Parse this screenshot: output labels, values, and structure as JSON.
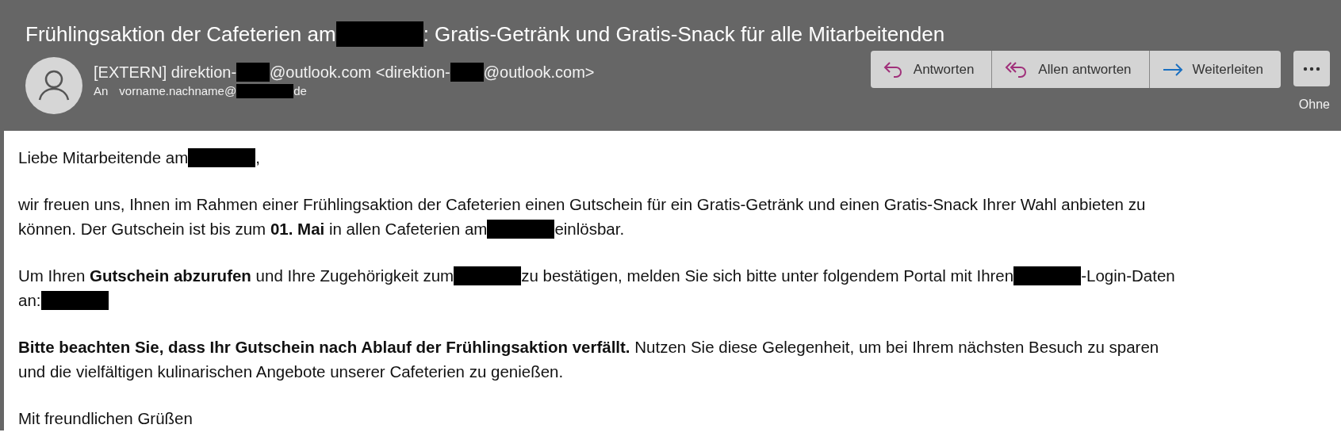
{
  "subject": [
    {
      "kind": "text",
      "text": "Frühlingsaktion der Cafeterien am"
    },
    {
      "kind": "redaction"
    },
    {
      "kind": "text",
      "text": ": Gratis-Getränk und Gratis-Snack für alle Mitarbeitenden"
    }
  ],
  "sender": [
    {
      "kind": "text",
      "text": "[EXTERN] direktion-"
    },
    {
      "kind": "redaction"
    },
    {
      "kind": "text",
      "text": "@outlook.com <direktion-"
    },
    {
      "kind": "redaction"
    },
    {
      "kind": "text",
      "text": "@outlook.com>"
    }
  ],
  "to_label": "An",
  "recipient": [
    {
      "kind": "text",
      "text": "vorname.nachname@"
    },
    {
      "kind": "redaction"
    },
    {
      "kind": "text",
      "text": "de"
    }
  ],
  "actions": [
    {
      "kind": "reply",
      "label": "Antworten"
    },
    {
      "kind": "reply_all",
      "label": "Allen antworten"
    },
    {
      "kind": "forward",
      "label": "Weiterleiten"
    }
  ],
  "more_label": "Ohne",
  "body": [
    [
      [
        {
          "kind": "text",
          "text": "Liebe Mitarbeitende am"
        },
        {
          "kind": "redaction"
        },
        {
          "kind": "text",
          "text": ","
        }
      ]
    ],
    [
      [
        {
          "kind": "text",
          "text": "wir freuen uns, Ihnen im Rahmen einer Frühlingsaktion der Cafeterien einen Gutschein für ein Gratis-Getränk und einen Gratis-Snack Ihrer Wahl anbieten zu"
        }
      ],
      [
        {
          "kind": "text",
          "text": "können. Der Gutschein ist bis zum **01. Mai** in allen Cafeterien am"
        },
        {
          "kind": "redaction"
        },
        {
          "kind": "text",
          "text": "einlösbar."
        }
      ]
    ],
    [
      [
        {
          "kind": "text",
          "text": "Um Ihren **Gutschein abzurufen** und Ihre Zugehörigkeit zum"
        },
        {
          "kind": "redaction"
        },
        {
          "kind": "text",
          "text": "zu bestätigen, melden Sie sich bitte unter folgendem Portal mit Ihren"
        },
        {
          "kind": "redaction"
        },
        {
          "kind": "text",
          "text": "-Login-Daten"
        }
      ],
      [
        {
          "kind": "text",
          "text": "an:"
        },
        {
          "kind": "redaction"
        }
      ]
    ],
    [
      [
        {
          "kind": "text",
          "text": "**Bitte beachten Sie, dass Ihr Gutschein nach Ablauf der Frühlingsaktion verfällt.** Nutzen Sie diese Gelegenheit, um bei Ihrem nächsten Besuch zu sparen"
        }
      ],
      [
        {
          "kind": "text",
          "text": "und die vielfältigen kulinarischen Angebote unserer Cafeterien zu genießen."
        }
      ]
    ],
    [
      [
        {
          "kind": "text",
          "text": "Mit freundlichen Grüßen"
        }
      ]
    ]
  ]
}
